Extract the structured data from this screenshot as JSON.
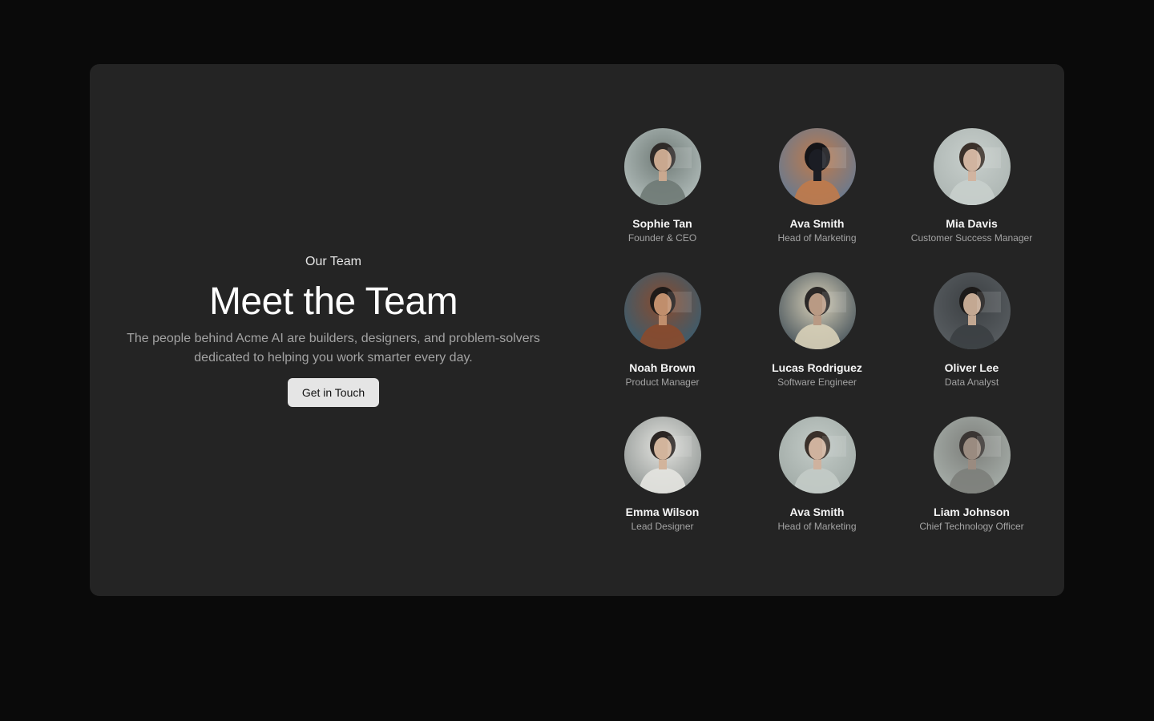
{
  "intro": {
    "eyebrow": "Our Team",
    "heading": "Meet the Team",
    "description": "The people behind Acme AI are builders, designers, and problem-solvers dedicated to helping you work smarter every day.",
    "cta_label": "Get in Touch"
  },
  "members": [
    {
      "name": "Sophie Tan",
      "role": "Founder & CEO",
      "bg": "#b7c2c0",
      "tone": "#6f7a76",
      "skin": "#c9a88f",
      "hair": "#2e2a28"
    },
    {
      "name": "Ava Smith",
      "role": "Head of Marketing",
      "bg": "#5d7a99",
      "tone": "#c07a4a",
      "skin": "#1b1d24",
      "hair": "#141417"
    },
    {
      "name": "Mia Davis",
      "role": "Customer Success Manager",
      "bg": "#aab3b0",
      "tone": "#c8cfcc",
      "skin": "#d1b4a0",
      "hair": "#3a302a"
    },
    {
      "name": "Noah Brown",
      "role": "Product Manager",
      "bg": "#2f5f78",
      "tone": "#8a4a2c",
      "skin": "#c08e6c",
      "hair": "#1f1a18"
    },
    {
      "name": "Lucas Rodriguez",
      "role": "Software Engineer",
      "bg": "#3c4a54",
      "tone": "#d8d0b8",
      "skin": "#b99a84",
      "hair": "#2a2726"
    },
    {
      "name": "Oliver Lee",
      "role": "Data Analyst",
      "bg": "#5b6064",
      "tone": "#3b3f42",
      "skin": "#c3a892",
      "hair": "#1c1a19"
    },
    {
      "name": "Emma Wilson",
      "role": "Lead Designer",
      "bg": "#8b918f",
      "tone": "#e4e4e0",
      "skin": "#d2b49c",
      "hair": "#2b2523"
    },
    {
      "name": "Ava Smith",
      "role": "Head of Marketing",
      "bg": "#9ea8a4",
      "tone": "#c3cbc7",
      "skin": "#cfb29e",
      "hair": "#3a302a"
    },
    {
      "name": "Liam Johnson",
      "role": "Chief Technology Officer",
      "bg": "#aab2ad",
      "tone": "#7c7e7a",
      "skin": "#9a8b80",
      "hair": "#3a3533"
    }
  ]
}
